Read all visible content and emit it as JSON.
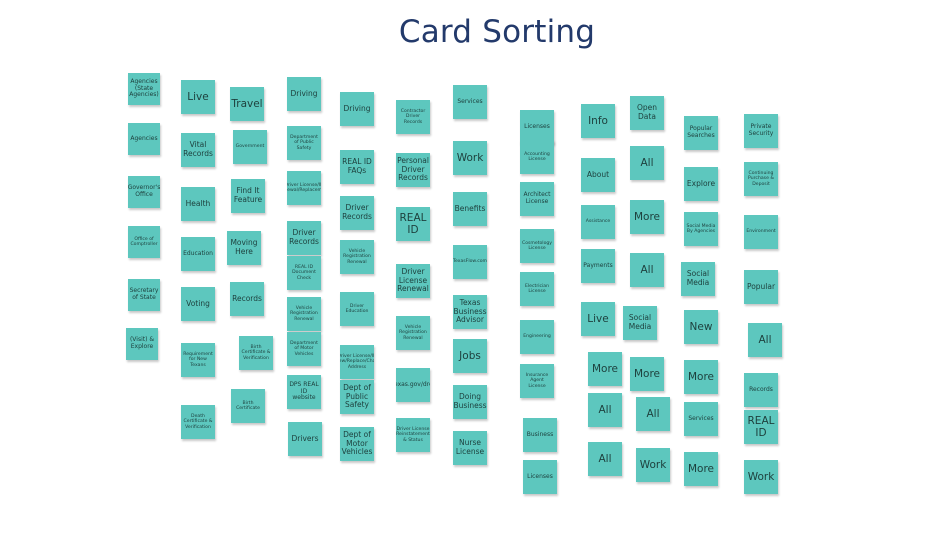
{
  "title": "Card Sorting",
  "columns": [
    {
      "cards": [
        "Agencies (State Agencies)",
        "Agencies",
        "Governor's Office",
        "Office of Comptroller",
        "Secretary of State",
        "(Visit) & Explore"
      ]
    },
    {
      "cards": [
        "Live",
        "Vital Records",
        "Health",
        "Education",
        "Voting",
        "Requirement for New Texans",
        "Death Certificate & Verification"
      ]
    },
    {
      "cards": [
        "Travel",
        "Government",
        "Find It Feature",
        "Moving Here",
        "Records",
        "Birth Certificate & Verification",
        "Birth Certificate"
      ]
    },
    {
      "cards": [
        "Driving",
        "Department of Public Safety",
        "Driver License/ID Renewal/Replacement",
        "Driver Records",
        "REAL ID Document Check",
        "Vehicle Registration Renewal",
        "Department of Motor Vehicles",
        "DPS REAL ID website",
        "Drivers"
      ]
    },
    {
      "cards": [
        "Driving",
        "REAL ID FAQs",
        "Driver Records",
        "Vehicle Registration Renewal",
        "Driver Education",
        "Driver License/ID Renew/Replace/Change Address",
        "Dept of Public Safety",
        "Dept of Motor Vehicles"
      ]
    },
    {
      "cards": [
        "Contractor Driver Records",
        "Personal Driver Records",
        "REAL ID",
        "Driver License Renewal",
        "Vehicle Registration Renewal",
        "www.texas.gov/drenewal",
        "Driver License Reinstatement & Status"
      ]
    },
    {
      "cards": [
        "Services",
        "Work",
        "Benefits",
        "TexasFlow.com",
        "Texas Business Advisor",
        "Jobs",
        "Doing Business",
        "Nurse License"
      ]
    },
    {
      "cards": [
        "Licenses",
        "Accounting License",
        "Architect License",
        "Cosmetology License",
        "Electrician License",
        "Engineering",
        "Insurance Agent License",
        "Business",
        "Licenses"
      ]
    },
    {
      "cards": [
        "Info",
        "About",
        "Assistance",
        "Payments",
        "Live",
        "More",
        "All",
        "All"
      ]
    },
    {
      "cards": [
        "Open Data",
        "All",
        "More",
        "All",
        "Social Media",
        "More",
        "All",
        "Work"
      ]
    },
    {
      "cards": [
        "Popular Searches",
        "Explore",
        "Social Media By Agencies",
        "Social Media",
        "New",
        "More",
        "Services",
        "More"
      ]
    },
    {
      "cards": [
        "Private Security",
        "Continuing Purchase & Deposit",
        "Environment",
        "Popular",
        "All",
        "Records",
        "REAL ID",
        "Work"
      ]
    }
  ]
}
